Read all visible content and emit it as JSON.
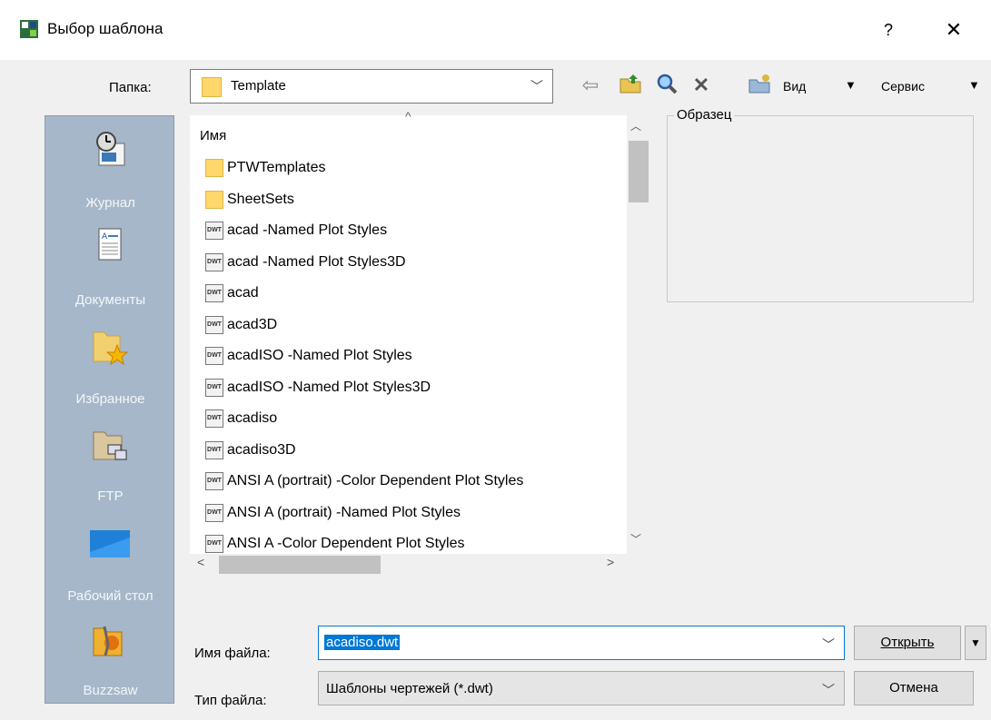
{
  "window": {
    "title": "Выбор шаблона",
    "help": "?",
    "close": "✕"
  },
  "toolbar": {
    "folder_label": "Папка:",
    "folder_value": "Template",
    "view_label": "Вид",
    "service_label": "Сервис"
  },
  "places": [
    {
      "label": "Журнал",
      "icon": "history-icon"
    },
    {
      "label": "Документы",
      "icon": "documents-icon"
    },
    {
      "label": "Избранное",
      "icon": "favorites-icon"
    },
    {
      "label": "FTP",
      "icon": "ftp-icon"
    },
    {
      "label": "Рабочий стол",
      "icon": "desktop-icon"
    },
    {
      "label": "Buzzsaw",
      "icon": "buzzsaw-icon"
    }
  ],
  "filelist": {
    "column_header": "Имя",
    "items": [
      {
        "name": "PTWTemplates",
        "type": "folder"
      },
      {
        "name": "SheetSets",
        "type": "folder"
      },
      {
        "name": "acad -Named Plot Styles",
        "type": "dwt"
      },
      {
        "name": "acad -Named Plot Styles3D",
        "type": "dwt"
      },
      {
        "name": "acad",
        "type": "dwt"
      },
      {
        "name": "acad3D",
        "type": "dwt"
      },
      {
        "name": "acadISO -Named Plot Styles",
        "type": "dwt"
      },
      {
        "name": "acadISO -Named Plot Styles3D",
        "type": "dwt"
      },
      {
        "name": "acadiso",
        "type": "dwt"
      },
      {
        "name": "acadiso3D",
        "type": "dwt"
      },
      {
        "name": "ANSI A (portrait) -Color Dependent Plot Styles",
        "type": "dwt"
      },
      {
        "name": "ANSI A (portrait) -Named Plot Styles",
        "type": "dwt"
      },
      {
        "name": "ANSI A -Color Dependent Plot Styles",
        "type": "dwt"
      }
    ],
    "file_icon_text": "DWT"
  },
  "preview": {
    "label": "Образец"
  },
  "bottom": {
    "filename_label": "Имя файла:",
    "filename_value": "acadiso.dwt",
    "filetype_label": "Тип файла:",
    "filetype_value": "Шаблоны чертежей (*.dwt)",
    "open_label": "Открыть",
    "cancel_label": "Отмена"
  },
  "colors": {
    "sidebar": "#a6b7c9",
    "selection": "#0078d7",
    "folder": "#ffd76b"
  }
}
